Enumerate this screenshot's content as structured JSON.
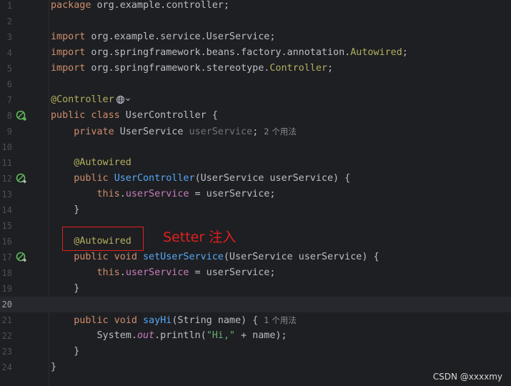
{
  "editor": {
    "lines": [
      {
        "num": "1",
        "segments": [
          {
            "t": "package",
            "c": "kw"
          },
          {
            "t": " org.example.controller;"
          }
        ]
      },
      {
        "num": "2",
        "segments": []
      },
      {
        "num": "3",
        "segments": [
          {
            "t": "import",
            "c": "kw"
          },
          {
            "t": " org.example.service.UserService;"
          }
        ]
      },
      {
        "num": "4",
        "segments": [
          {
            "t": "import",
            "c": "kw"
          },
          {
            "t": " org.springframework.beans.factory.annotation."
          },
          {
            "t": "Autowired",
            "c": "ann"
          },
          {
            "t": ";"
          }
        ]
      },
      {
        "num": "5",
        "segments": [
          {
            "t": "import",
            "c": "kw"
          },
          {
            "t": " org.springframework.stereotype."
          },
          {
            "t": "Controller",
            "c": "ann"
          },
          {
            "t": ";"
          }
        ]
      },
      {
        "num": "6",
        "segments": []
      },
      {
        "num": "7",
        "segments": [
          {
            "t": "@Controller",
            "c": "ann"
          }
        ],
        "globe": true
      },
      {
        "num": "8",
        "segments": [
          {
            "t": "public class",
            "c": "kw"
          },
          {
            "t": " UserController {"
          }
        ],
        "icon": "bean"
      },
      {
        "num": "9",
        "segments": [
          {
            "t": "    "
          },
          {
            "t": "private",
            "c": "kw"
          },
          {
            "t": " UserService "
          },
          {
            "t": "userService",
            "c": "fld-gray"
          },
          {
            "t": ";"
          }
        ],
        "hint": "2 个用法"
      },
      {
        "num": "10",
        "segments": []
      },
      {
        "num": "11",
        "segments": [
          {
            "t": "    "
          },
          {
            "t": "@Autowired",
            "c": "ann"
          }
        ]
      },
      {
        "num": "12",
        "segments": [
          {
            "t": "    "
          },
          {
            "t": "public",
            "c": "kw"
          },
          {
            "t": " "
          },
          {
            "t": "UserController",
            "c": "fn"
          },
          {
            "t": "(UserService userService) {"
          }
        ],
        "icon": "inject"
      },
      {
        "num": "13",
        "segments": [
          {
            "t": "        "
          },
          {
            "t": "this",
            "c": "kw"
          },
          {
            "t": "."
          },
          {
            "t": "userService",
            "c": "fld"
          },
          {
            "t": " = userService;"
          }
        ]
      },
      {
        "num": "14",
        "segments": [
          {
            "t": "    }"
          }
        ]
      },
      {
        "num": "15",
        "segments": []
      },
      {
        "num": "16",
        "segments": [
          {
            "t": "    "
          },
          {
            "t": "@Autowired",
            "c": "ann"
          }
        ]
      },
      {
        "num": "17",
        "segments": [
          {
            "t": "    "
          },
          {
            "t": "public void",
            "c": "kw"
          },
          {
            "t": " "
          },
          {
            "t": "setUserService",
            "c": "fn"
          },
          {
            "t": "(UserService userService) {"
          }
        ],
        "icon": "inject"
      },
      {
        "num": "18",
        "segments": [
          {
            "t": "        "
          },
          {
            "t": "this",
            "c": "kw"
          },
          {
            "t": "."
          },
          {
            "t": "userService",
            "c": "fld"
          },
          {
            "t": " = userService;"
          }
        ]
      },
      {
        "num": "19",
        "segments": [
          {
            "t": "    }"
          }
        ]
      },
      {
        "num": "20",
        "segments": [],
        "current": true
      },
      {
        "num": "21",
        "segments": [
          {
            "t": "    "
          },
          {
            "t": "public void",
            "c": "kw"
          },
          {
            "t": " "
          },
          {
            "t": "sayHi",
            "c": "fn"
          },
          {
            "t": "(String name) {"
          }
        ],
        "hint": "1 个用法"
      },
      {
        "num": "22",
        "segments": [
          {
            "t": "        System."
          },
          {
            "t": "out",
            "c": "ital"
          },
          {
            "t": ".println("
          },
          {
            "t": "\"Hi,\"",
            "c": "str"
          },
          {
            "t": " + name);"
          }
        ]
      },
      {
        "num": "23",
        "segments": [
          {
            "t": "    }"
          }
        ]
      },
      {
        "num": "24",
        "segments": [
          {
            "t": "}"
          }
        ]
      }
    ]
  },
  "annotation": {
    "text": "Setter 注入",
    "color": "#e02020"
  },
  "watermark": {
    "text": "CSDN @xxxxmy"
  },
  "icons": {
    "bean": "spring-bean-icon",
    "inject": "spring-autowire-icon",
    "globe": "web-globe-icon"
  }
}
